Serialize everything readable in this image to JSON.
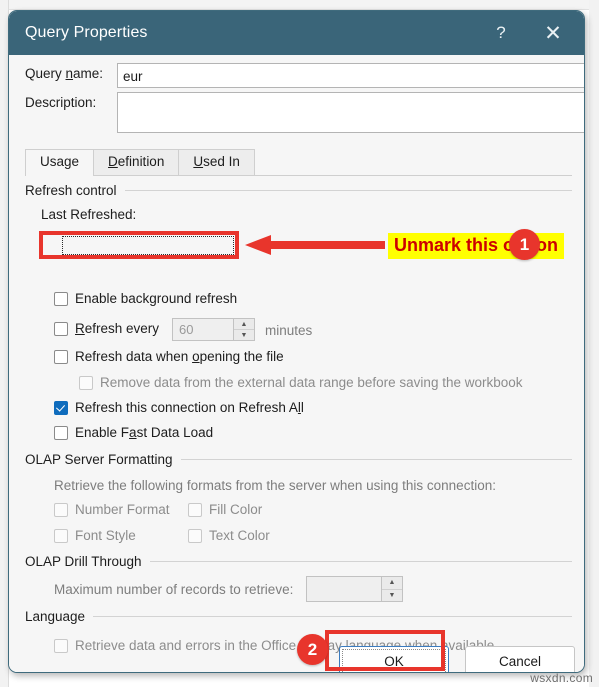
{
  "window": {
    "title": "Query Properties",
    "help_icon": "?",
    "close_icon": "✕",
    "accent_titlebar_color": "#3a6579"
  },
  "form": {
    "query_name_label": "Query name:",
    "query_name_value": "eur",
    "query_name_placeholder": "",
    "description_label": "Description:",
    "description_value": "",
    "description_placeholder": ""
  },
  "tabs": [
    {
      "label": "Usage",
      "active": true
    },
    {
      "label": "Definition",
      "active": false
    },
    {
      "label": "Used In",
      "active": false
    }
  ],
  "refresh_control": {
    "group_title": "Refresh control",
    "last_refreshed_label": "Last Refreshed:",
    "options": [
      {
        "label": "Enable background refresh",
        "checked": false,
        "disabled": false
      },
      {
        "label": "Refresh every",
        "checked": false,
        "disabled": false
      },
      {
        "label": "Refresh data when opening the file",
        "checked": false,
        "disabled": false
      },
      {
        "label": "Remove data from the external data range before saving the workbook",
        "checked": false,
        "disabled": true
      },
      {
        "label": "Refresh this connection on Refresh All",
        "checked": true,
        "disabled": false
      },
      {
        "label": "Enable Fast Data Load",
        "checked": false,
        "disabled": false
      }
    ],
    "interval_value": "60",
    "interval_units": "minutes",
    "spinner_up_icon": "▲",
    "spinner_down_icon": "▼"
  },
  "olap_server_formatting": {
    "group_title": "OLAP Server Formatting",
    "description": "Retrieve the following formats from the server when using this connection:",
    "options": [
      {
        "label": "Number Format",
        "checked": false,
        "disabled": true
      },
      {
        "label": "Fill Color",
        "checked": false,
        "disabled": true
      },
      {
        "label": "Font Style",
        "checked": false,
        "disabled": true
      },
      {
        "label": "Text Color",
        "checked": false,
        "disabled": true
      }
    ]
  },
  "olap_drill_through": {
    "group_title": "OLAP Drill Through",
    "max_records_label": "Maximum number of records to retrieve:",
    "max_records_value": "",
    "max_records_placeholder": ""
  },
  "language": {
    "group_title": "Language",
    "option_label": "Retrieve data and errors in the Office display language when available",
    "checked": false,
    "disabled": true
  },
  "footer": {
    "ok_label": "OK",
    "cancel_label": "Cancel"
  },
  "annotations": {
    "callout_1_text": "Unmark this option",
    "badge_1": "1",
    "badge_2": "2",
    "highlight_color": "#ffff00",
    "callout_text_color": "#cc0000",
    "marker_color": "#e8352c",
    "arrow_icon": "left-arrow-icon"
  },
  "watermark": "wsxdn.com"
}
